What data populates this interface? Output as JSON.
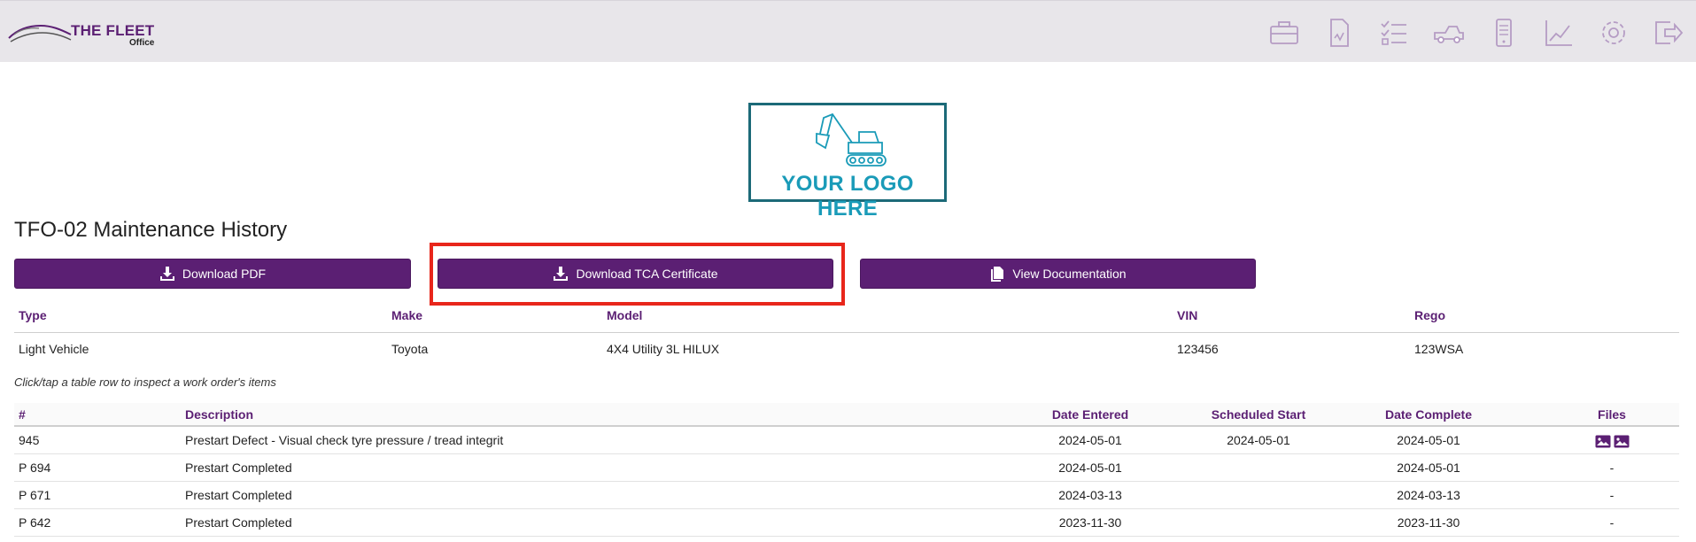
{
  "brand": {
    "title": "THE FLEET",
    "subtitle": "Office"
  },
  "nav": [
    {
      "name": "toolbox-icon"
    },
    {
      "name": "report-icon"
    },
    {
      "name": "checklist-icon"
    },
    {
      "name": "vehicle-icon"
    },
    {
      "name": "mobile-icon"
    },
    {
      "name": "chart-icon"
    },
    {
      "name": "gear-icon"
    },
    {
      "name": "logout-icon"
    }
  ],
  "logo": {
    "text": "YOUR LOGO HERE"
  },
  "page": {
    "title": "TFO-02 Maintenance History"
  },
  "buttons": {
    "download_pdf": "Download PDF",
    "download_tca": "Download TCA Certificate",
    "view_docs": "View Documentation"
  },
  "vehicle": {
    "headers": {
      "type": "Type",
      "make": "Make",
      "model": "Model",
      "vin": "VIN",
      "rego": "Rego"
    },
    "values": {
      "type": "Light Vehicle",
      "make": "Toyota",
      "model": "4X4 Utility 3L HILUX",
      "vin": "123456",
      "rego": "123WSA"
    }
  },
  "hint": "Click/tap a table row to inspect a work order's items",
  "work_orders": {
    "headers": {
      "num": "#",
      "desc": "Description",
      "date_entered": "Date Entered",
      "scheduled_start": "Scheduled Start",
      "date_complete": "Date Complete",
      "files": "Files"
    },
    "rows": [
      {
        "num": "945",
        "desc": "Prestart Defect - Visual check tyre pressure / tread integrit",
        "date_entered": "2024-05-01",
        "scheduled_start": "2024-05-01",
        "date_complete": "2024-05-01",
        "files": ""
      },
      {
        "num": "P 694",
        "desc": "Prestart Completed",
        "date_entered": "2024-05-01",
        "scheduled_start": "",
        "date_complete": "2024-05-01",
        "files": "-"
      },
      {
        "num": "P 671",
        "desc": "Prestart Completed",
        "date_entered": "2024-03-13",
        "scheduled_start": "",
        "date_complete": "2024-03-13",
        "files": "-"
      },
      {
        "num": "P 642",
        "desc": "Prestart Completed",
        "date_entered": "2023-11-30",
        "scheduled_start": "",
        "date_complete": "2023-11-30",
        "files": "-"
      }
    ]
  },
  "colors": {
    "accent": "#5b1f73",
    "highlight": "#e8261b",
    "logo": "#1a9bb8"
  }
}
